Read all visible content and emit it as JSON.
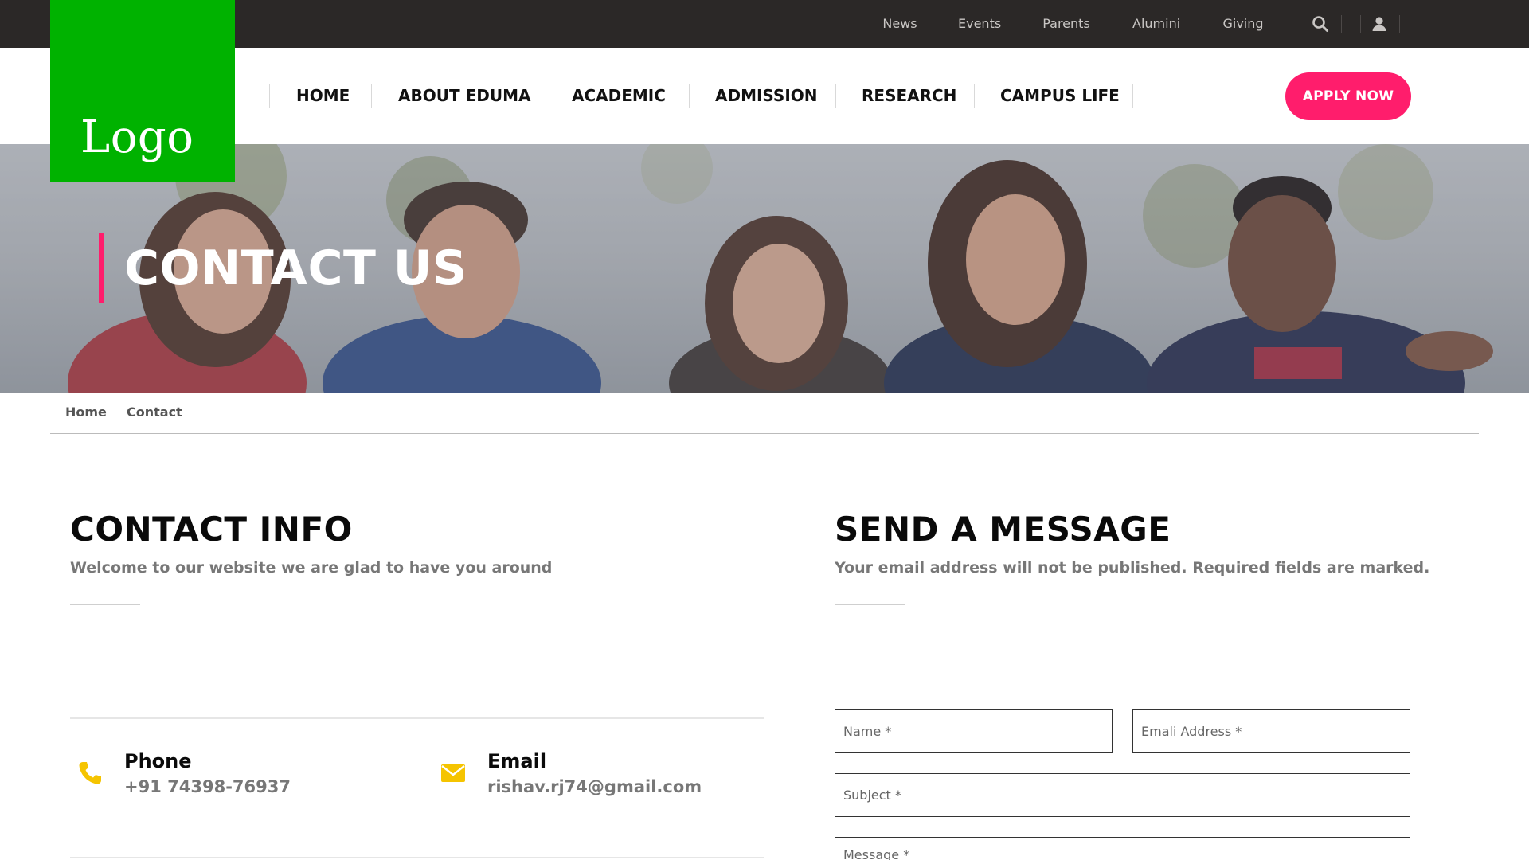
{
  "topbar": {
    "links": [
      "News",
      "Events",
      "Parents",
      "Alumini",
      "Giving"
    ],
    "icons": [
      "search-icon",
      "user-icon"
    ]
  },
  "header": {
    "logo_text": "Logo",
    "nav": [
      "HOME",
      "ABOUT EDUMA",
      "ACADEMIC",
      "ADMISSION",
      "RESEARCH",
      "CAMPUS LIFE"
    ],
    "apply_label": "APPLY NOW"
  },
  "hero": {
    "title": "CONTACT US"
  },
  "breadcrumb": {
    "home": "Home",
    "current": "Contact"
  },
  "contact_info": {
    "title": "CONTACT INFO",
    "subtitle": "Welcome to our website we are glad to have you around",
    "phone_label": "Phone",
    "phone_value": "+91 74398-76937",
    "email_label": "Email",
    "email_value": "rishav.rj74@gmail.com"
  },
  "send_message": {
    "title": "SEND A MESSAGE",
    "subtitle": "Your email address will not be published. Required fields are marked.",
    "name_placeholder": "Name *",
    "email_placeholder": "Emali Address *",
    "subject_placeholder": "Subject *",
    "message_placeholder": "Message *"
  },
  "colors": {
    "topbar": "#2b2827",
    "logo": "#00b200",
    "accent": "#ff1d6c",
    "icon": "#f5c400"
  }
}
